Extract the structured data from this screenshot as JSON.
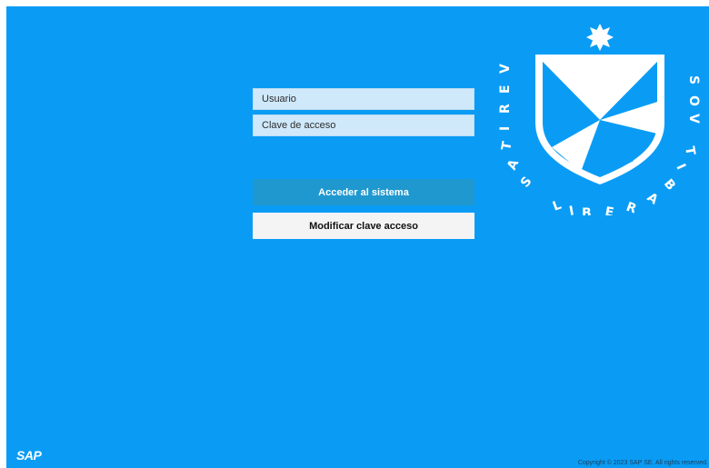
{
  "login": {
    "username_placeholder": "Usuario",
    "password_placeholder": "Clave de acceso",
    "login_button": "Acceder al sistema",
    "change_password_button": "Modificar clave acceso"
  },
  "branding": {
    "motto": "VERITAS LIBERABIT VOS",
    "sap_logo": "SAP"
  },
  "footer": {
    "copyright": "Copyright © 2023 SAP SE. All rights reserved."
  },
  "colors": {
    "background": "#0a9cf5",
    "field": "#cfe9fb",
    "login_button": "#1f98cf",
    "change_button": "#f4f4f4",
    "shield": "#ffffff"
  },
  "icons": {
    "star": "eight-point-star-icon",
    "shield": "shield-crest-icon"
  }
}
